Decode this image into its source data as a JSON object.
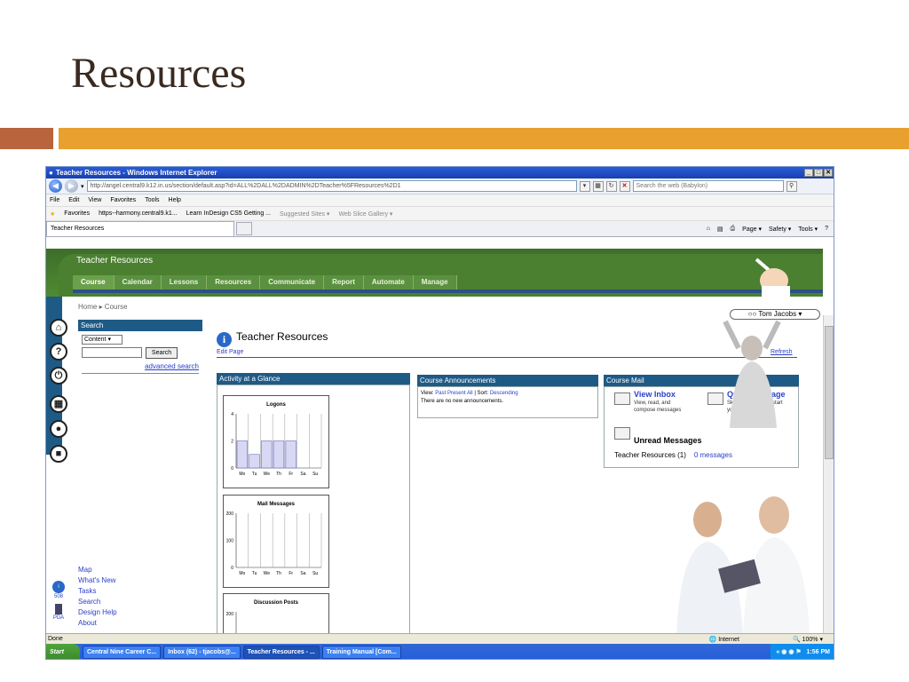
{
  "slide": {
    "title": "Resources"
  },
  "browser": {
    "window_title": "Teacher Resources - Windows Internet Explorer",
    "address_url": "http://angel.central9.k12.in.us/section/default.asp?id=ALL%2DALL%2DADMIN%2DTeacher%5FResources%2D1",
    "search_placeholder": "Search the web (Babylon)",
    "menu": [
      "File",
      "Edit",
      "View",
      "Favorites",
      "Tools",
      "Help"
    ],
    "favorites_label": "Favorites",
    "favorites": [
      "https--harmony.central9.k1...",
      "Learn InDesign CS5 Getting ...",
      "Suggested Sites ▾",
      "Web Slice Gallery ▾"
    ],
    "tab_title": "Teacher Resources",
    "command_bar": [
      "Page ▾",
      "Safety ▾",
      "Tools ▾"
    ],
    "status_left": "Done",
    "zone": "Internet",
    "zoom": "100%"
  },
  "angel": {
    "course_name": "Teacher Resources",
    "nav_tabs": [
      "Course",
      "Calendar",
      "Lessons",
      "Resources",
      "Communicate",
      "Report",
      "Automate",
      "Manage"
    ],
    "breadcrumb": "Home ▸ Course",
    "user": "Tom Jacobs",
    "search_header": "Search",
    "search_select": "Content",
    "search_button": "Search",
    "advanced_search": "advanced search",
    "page_title": "Teacher Resources",
    "edit_page": "Edit Page",
    "refresh": "Refresh",
    "bottom_links": [
      "Map",
      "What's New",
      "Tasks",
      "Search",
      "Design Help",
      "About"
    ],
    "dock_labels": [
      "508",
      "PDA"
    ],
    "activity_header": "Activity at a Glance",
    "announcements_header": "Course Announcements",
    "announcements_view": "View:",
    "announcements_links": [
      "Past",
      "Present",
      "All"
    ],
    "announcements_sort": "| Sort:",
    "announcements_sort_value": "Descending",
    "announcements_empty": "There are no new announcements.",
    "mail_header": "Course Mail",
    "view_inbox": "View Inbox",
    "view_inbox_sub": "View, read, and compose messages",
    "quick_message": "Quick Message",
    "quick_message_sub": "Skip the inbox and start your message.",
    "unread_messages": "Unread Messages",
    "unread_course": "Teacher Resources (1)",
    "unread_count": "0 messages"
  },
  "taskbar": {
    "start": "Start",
    "tasks": [
      "Central Nine Career C...",
      "Inbox (62) - tjacobs@...",
      "Teacher Resources - ...",
      "Training Manual [Com..."
    ],
    "clock": "1:56 PM"
  },
  "chart_data": [
    {
      "type": "bar",
      "title": "Logons",
      "categories": [
        "Mo",
        "Tu",
        "We",
        "Th",
        "Fr",
        "Sa",
        "Su"
      ],
      "values": [
        2,
        1,
        2,
        2,
        2,
        0,
        0
      ],
      "ylim": [
        0,
        4
      ],
      "yticks": [
        0,
        2,
        4
      ]
    },
    {
      "type": "bar",
      "title": "Mail Messages",
      "categories": [
        "Mo",
        "Tu",
        "We",
        "Th",
        "Fr",
        "Sa",
        "Su"
      ],
      "values": [
        0,
        0,
        0,
        0,
        0,
        0,
        0
      ],
      "ylim": [
        0,
        200
      ],
      "yticks": [
        0,
        100,
        200
      ]
    },
    {
      "type": "bar",
      "title": "Discussion Posts",
      "categories": [],
      "values": [],
      "yticks": [
        200
      ]
    }
  ],
  "colors": {
    "accent_orange": "#e8a02e",
    "accent_rust": "#b8643c",
    "angel_green": "#4a8030",
    "angel_blue": "#1e5a86",
    "link": "#2a40c8"
  }
}
